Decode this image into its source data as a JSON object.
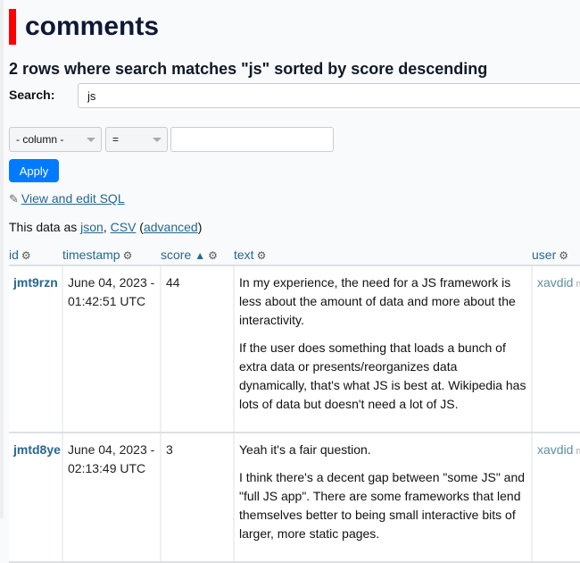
{
  "page": {
    "title": "comments",
    "subtitle": "2 rows where search matches \"js\" sorted by score descending",
    "accent_color": "#ff0000"
  },
  "search": {
    "label": "Search:",
    "value": "js"
  },
  "filter": {
    "column_select": "- column -",
    "operator_select": "=",
    "value": "",
    "apply_label": "Apply"
  },
  "links": {
    "pencil_icon": "✎",
    "view_edit_sql": "View and edit SQL",
    "export_prefix": "This data as ",
    "json": "json",
    "comma": ", ",
    "csv": "CSV",
    "open_paren": " (",
    "advanced": "advanced",
    "close_paren": ")"
  },
  "table": {
    "gear_icon": "⚙",
    "sort_icon": "▲",
    "columns": [
      {
        "label": "id"
      },
      {
        "label": "timestamp"
      },
      {
        "label": "score",
        "sorted": true
      },
      {
        "label": "text"
      },
      {
        "label": "user"
      }
    ],
    "rows": [
      {
        "id": "jmt9rzn",
        "timestamp_line1": "June 04, 2023 -",
        "timestamp_line2": "01:42:51 UTC",
        "score": "44",
        "text": [
          "In my experience, the need for a JS framework is less about the amount of data and more about the interactivity.",
          "If the user does something that loads a bunch of extra data or presents/reorganizes data dynamically, that's what JS is best at. Wikipedia has lots of data but doesn't need a lot of JS."
        ],
        "user": "xavdid",
        "user_suffix": "m"
      },
      {
        "id": "jmtd8ye",
        "timestamp_line1": "June 04, 2023 -",
        "timestamp_line2": "02:13:49 UTC",
        "score": "3",
        "text": [
          "Yeah it's a fair question.",
          "I think there's a decent gap between \"some JS\" and \"full JS app\". There are some frameworks that lend themselves better to being small interactive bits of larger, more static pages."
        ],
        "user": "xavdid",
        "user_suffix": "m"
      }
    ]
  }
}
